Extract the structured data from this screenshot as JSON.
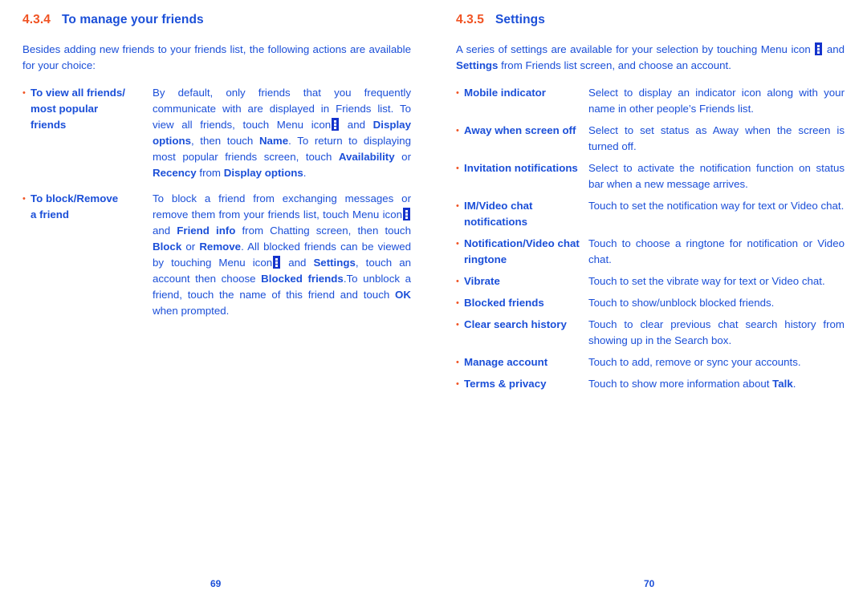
{
  "document": {
    "accent_orange": "#f05323",
    "accent_blue": "#1b4fd8",
    "icon_blue": "#1433cc"
  },
  "left_page": {
    "folio": "69",
    "heading": {
      "number": "4.3.4",
      "title": "To manage your friends"
    },
    "intro": "Besides adding new friends to your friends list, the following actions are available for your choice:",
    "bullet_char": "•",
    "items": [
      {
        "term": "To view all friends/ most popular friends",
        "term_part1": "To view all friends/",
        "term_part2": "most popular",
        "term_part3": "friends",
        "desc_seg1": "By default, only friends that you frequently communicate with are displayed in Friends list. To view all friends, touch Menu icon",
        "desc_seg2": "and",
        "desc_bold1": "Display options",
        "desc_seg3": ", then touch",
        "desc_bold2": "Name",
        "desc_seg4": ". To return to displaying most popular friends screen, touch",
        "desc_bold3": "Availability",
        "desc_seg5": "or",
        "desc_bold4": "Recency",
        "desc_seg6": "from",
        "desc_bold5": "Display options",
        "desc_seg7": "."
      },
      {
        "term": "To block/Remove a friend",
        "term_part1": "To block/Remove",
        "term_part2": "a friend",
        "desc_seg1": "To block a friend from exchanging messages or remove them from your friends list, touch Menu icon",
        "desc_seg2": "and",
        "desc_bold1": "Friend info",
        "desc_seg3": "from Chatting screen, then touch",
        "desc_bold2": "Block",
        "desc_seg4": "or",
        "desc_bold3": "Remove",
        "desc_seg5": ". All blocked friends can be viewed by touching Menu icon",
        "desc_seg6": "and",
        "desc_bold4": "Settings",
        "desc_seg7": ", touch an account then choose",
        "desc_bold5": "Blocked friends",
        "desc_seg8": ".To unblock a friend, touch the name of this friend and touch",
        "desc_bold6": "OK",
        "desc_seg9": "when prompted."
      }
    ]
  },
  "right_page": {
    "folio": "70",
    "heading": {
      "number": "4.3.5",
      "title": "Settings"
    },
    "intro_seg1": "A series of settings are available for your selection by touching Menu icon",
    "intro_seg2": "and",
    "intro_bold1": "Settings",
    "intro_seg3": "from Friends list screen, and choose an account.",
    "bullet_char": "•",
    "items": [
      {
        "term": "Mobile indicator",
        "desc": "Select to display an indicator icon along with your name in other people’s Friends list."
      },
      {
        "term": "Away when screen off",
        "desc": "Select to set status as Away when the screen is turned off."
      },
      {
        "term": "Invitation notifications",
        "desc": "Select to activate the notification function on status bar when a new message arrives."
      },
      {
        "term": "IM/Video chat notifications",
        "desc": "Touch to set the notification way for text or Video chat."
      },
      {
        "term": "Notification/Video chat ringtone",
        "desc": "Touch to choose a ringtone for notification or Video chat."
      },
      {
        "term": "Vibrate",
        "desc": "Touch to set the vibrate way for text or Video chat."
      },
      {
        "term": "Blocked friends",
        "desc": "Touch to show/unblock blocked friends."
      },
      {
        "term": "Clear search history",
        "desc": "Touch to clear previous chat search history from showing up in the Search box."
      },
      {
        "term": "Manage account",
        "desc": "Touch to add, remove or sync your accounts."
      },
      {
        "term": "Terms & privacy",
        "desc_seg1": "Touch to show more information about",
        "desc_bold1": "Talk",
        "desc_seg2": "."
      }
    ]
  }
}
